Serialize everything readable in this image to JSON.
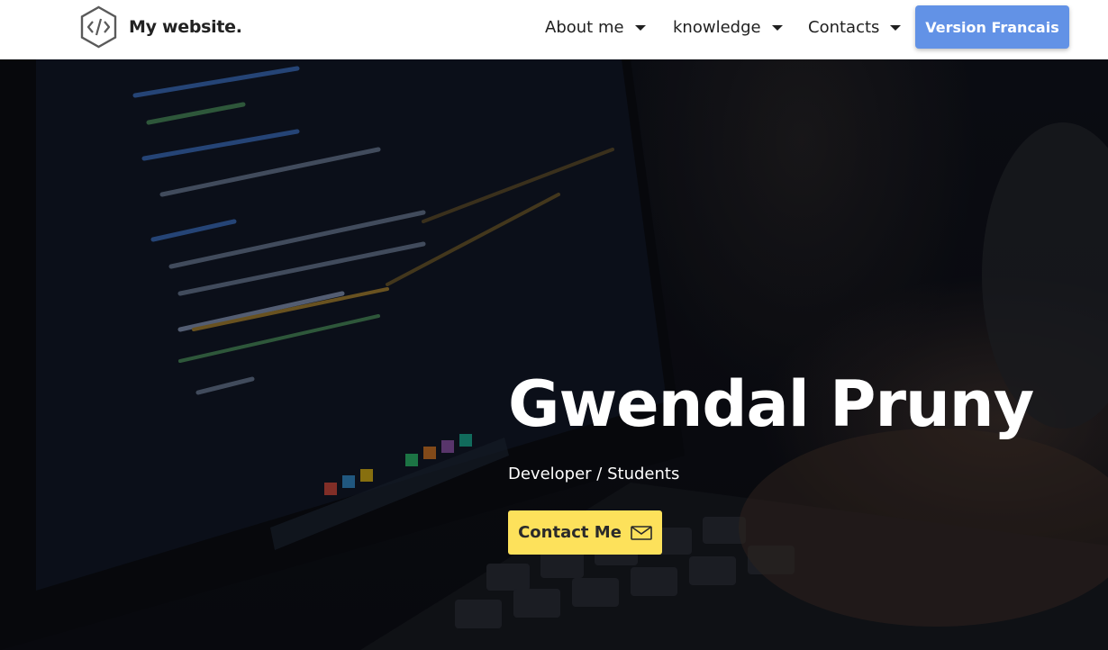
{
  "nav": {
    "brand": {
      "name": "My website.",
      "logo_icon": "code-hexagon-icon"
    },
    "menus": [
      {
        "label": "About me"
      },
      {
        "label": "knowledge"
      },
      {
        "label": "Contacts"
      }
    ],
    "version_button": "Version Francais"
  },
  "hero": {
    "title": "Gwendal Pruny",
    "subtitle": "Developer / Students",
    "cta_label": "Contact Me",
    "cta_icon": "mail-icon"
  },
  "colors": {
    "accent_blue": "#6292e6",
    "cta_yellow": "#fde15b",
    "nav_bg": "#ffffff",
    "hero_bg": "#0b0d14"
  }
}
